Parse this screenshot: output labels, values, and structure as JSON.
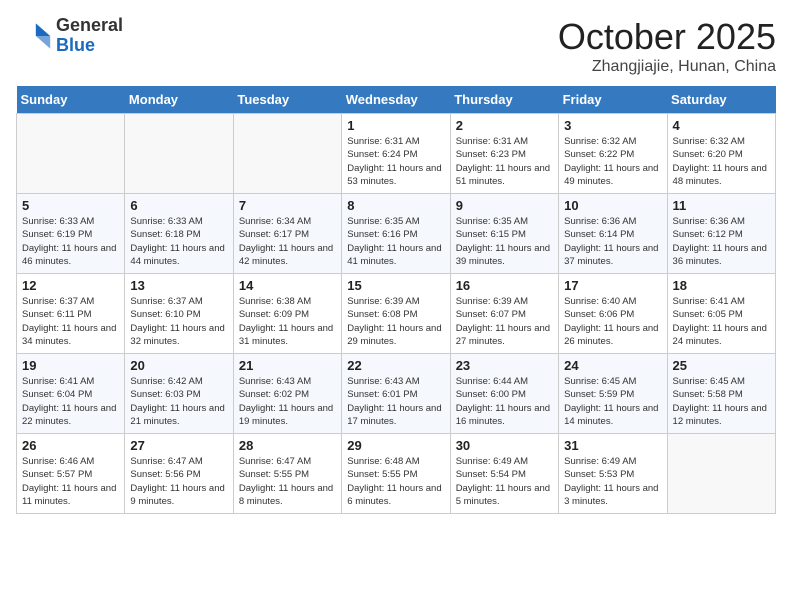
{
  "header": {
    "logo_general": "General",
    "logo_blue": "Blue",
    "month_title": "October 2025",
    "location": "Zhangjiajie, Hunan, China"
  },
  "weekdays": [
    "Sunday",
    "Monday",
    "Tuesday",
    "Wednesday",
    "Thursday",
    "Friday",
    "Saturday"
  ],
  "weeks": [
    [
      {
        "day": "",
        "info": ""
      },
      {
        "day": "",
        "info": ""
      },
      {
        "day": "",
        "info": ""
      },
      {
        "day": "1",
        "info": "Sunrise: 6:31 AM\nSunset: 6:24 PM\nDaylight: 11 hours\nand 53 minutes."
      },
      {
        "day": "2",
        "info": "Sunrise: 6:31 AM\nSunset: 6:23 PM\nDaylight: 11 hours\nand 51 minutes."
      },
      {
        "day": "3",
        "info": "Sunrise: 6:32 AM\nSunset: 6:22 PM\nDaylight: 11 hours\nand 49 minutes."
      },
      {
        "day": "4",
        "info": "Sunrise: 6:32 AM\nSunset: 6:20 PM\nDaylight: 11 hours\nand 48 minutes."
      }
    ],
    [
      {
        "day": "5",
        "info": "Sunrise: 6:33 AM\nSunset: 6:19 PM\nDaylight: 11 hours\nand 46 minutes."
      },
      {
        "day": "6",
        "info": "Sunrise: 6:33 AM\nSunset: 6:18 PM\nDaylight: 11 hours\nand 44 minutes."
      },
      {
        "day": "7",
        "info": "Sunrise: 6:34 AM\nSunset: 6:17 PM\nDaylight: 11 hours\nand 42 minutes."
      },
      {
        "day": "8",
        "info": "Sunrise: 6:35 AM\nSunset: 6:16 PM\nDaylight: 11 hours\nand 41 minutes."
      },
      {
        "day": "9",
        "info": "Sunrise: 6:35 AM\nSunset: 6:15 PM\nDaylight: 11 hours\nand 39 minutes."
      },
      {
        "day": "10",
        "info": "Sunrise: 6:36 AM\nSunset: 6:14 PM\nDaylight: 11 hours\nand 37 minutes."
      },
      {
        "day": "11",
        "info": "Sunrise: 6:36 AM\nSunset: 6:12 PM\nDaylight: 11 hours\nand 36 minutes."
      }
    ],
    [
      {
        "day": "12",
        "info": "Sunrise: 6:37 AM\nSunset: 6:11 PM\nDaylight: 11 hours\nand 34 minutes."
      },
      {
        "day": "13",
        "info": "Sunrise: 6:37 AM\nSunset: 6:10 PM\nDaylight: 11 hours\nand 32 minutes."
      },
      {
        "day": "14",
        "info": "Sunrise: 6:38 AM\nSunset: 6:09 PM\nDaylight: 11 hours\nand 31 minutes."
      },
      {
        "day": "15",
        "info": "Sunrise: 6:39 AM\nSunset: 6:08 PM\nDaylight: 11 hours\nand 29 minutes."
      },
      {
        "day": "16",
        "info": "Sunrise: 6:39 AM\nSunset: 6:07 PM\nDaylight: 11 hours\nand 27 minutes."
      },
      {
        "day": "17",
        "info": "Sunrise: 6:40 AM\nSunset: 6:06 PM\nDaylight: 11 hours\nand 26 minutes."
      },
      {
        "day": "18",
        "info": "Sunrise: 6:41 AM\nSunset: 6:05 PM\nDaylight: 11 hours\nand 24 minutes."
      }
    ],
    [
      {
        "day": "19",
        "info": "Sunrise: 6:41 AM\nSunset: 6:04 PM\nDaylight: 11 hours\nand 22 minutes."
      },
      {
        "day": "20",
        "info": "Sunrise: 6:42 AM\nSunset: 6:03 PM\nDaylight: 11 hours\nand 21 minutes."
      },
      {
        "day": "21",
        "info": "Sunrise: 6:43 AM\nSunset: 6:02 PM\nDaylight: 11 hours\nand 19 minutes."
      },
      {
        "day": "22",
        "info": "Sunrise: 6:43 AM\nSunset: 6:01 PM\nDaylight: 11 hours\nand 17 minutes."
      },
      {
        "day": "23",
        "info": "Sunrise: 6:44 AM\nSunset: 6:00 PM\nDaylight: 11 hours\nand 16 minutes."
      },
      {
        "day": "24",
        "info": "Sunrise: 6:45 AM\nSunset: 5:59 PM\nDaylight: 11 hours\nand 14 minutes."
      },
      {
        "day": "25",
        "info": "Sunrise: 6:45 AM\nSunset: 5:58 PM\nDaylight: 11 hours\nand 12 minutes."
      }
    ],
    [
      {
        "day": "26",
        "info": "Sunrise: 6:46 AM\nSunset: 5:57 PM\nDaylight: 11 hours\nand 11 minutes."
      },
      {
        "day": "27",
        "info": "Sunrise: 6:47 AM\nSunset: 5:56 PM\nDaylight: 11 hours\nand 9 minutes."
      },
      {
        "day": "28",
        "info": "Sunrise: 6:47 AM\nSunset: 5:55 PM\nDaylight: 11 hours\nand 8 minutes."
      },
      {
        "day": "29",
        "info": "Sunrise: 6:48 AM\nSunset: 5:55 PM\nDaylight: 11 hours\nand 6 minutes."
      },
      {
        "day": "30",
        "info": "Sunrise: 6:49 AM\nSunset: 5:54 PM\nDaylight: 11 hours\nand 5 minutes."
      },
      {
        "day": "31",
        "info": "Sunrise: 6:49 AM\nSunset: 5:53 PM\nDaylight: 11 hours\nand 3 minutes."
      },
      {
        "day": "",
        "info": ""
      }
    ]
  ]
}
